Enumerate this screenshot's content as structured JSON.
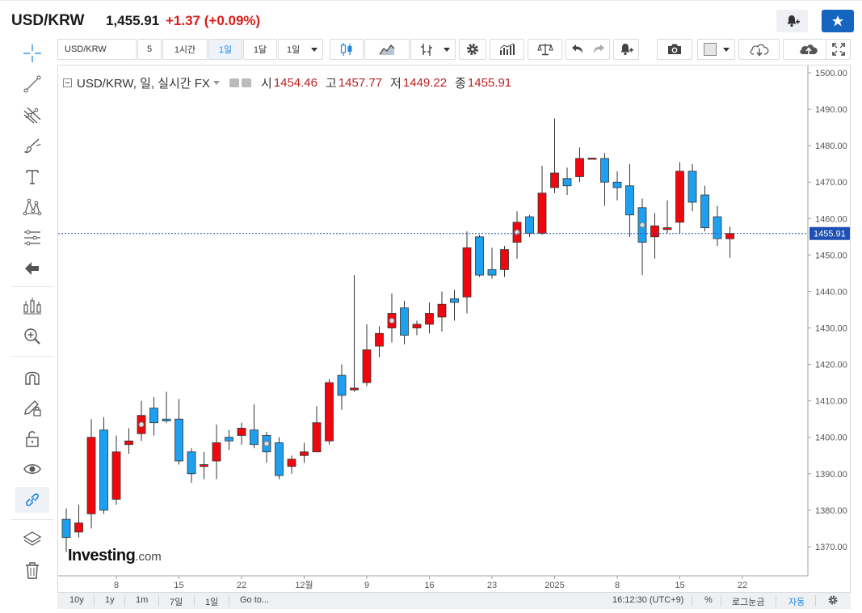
{
  "header": {
    "symbol": "USD/KRW",
    "price": "1,455.91",
    "change": "+1.37",
    "change_pct": "(+0.09%)"
  },
  "toolbar": {
    "symbol_value": "USD/KRW",
    "interval_5": "5",
    "interval_1h": "1시간",
    "interval_1d": "1일",
    "interval_1mo": "1달",
    "interval_1d_dropdown": "1일",
    "active_interval": "1일"
  },
  "legend": {
    "title": "USD/KRW, 일, 실시간 FX",
    "open_label": "시",
    "open": "1454.46",
    "high_label": "고",
    "high": "1457.77",
    "low_label": "저",
    "low": "1449.22",
    "close_label": "종",
    "close": "1455.91"
  },
  "watermark": {
    "brand": "Investing",
    "suffix": ".com"
  },
  "bottom": {
    "ranges": [
      "10y",
      "1y",
      "1m",
      "7일",
      "1일"
    ],
    "goto": "Go to...",
    "time": "16:12:30 (UTC+9)",
    "percent": "%",
    "log": "로그눈금",
    "auto": "자동"
  },
  "colors": {
    "up": "#f0070e",
    "down": "#1da0f0",
    "change": "#d91e18",
    "accent": "#1565c0"
  },
  "chart_data": {
    "type": "candlestick",
    "ylim": [
      1362,
      1502
    ],
    "yticks": [
      "1500.00",
      "1490.00",
      "1480.00",
      "1470.00",
      "1460.00",
      "1450.00",
      "1440.00",
      "1430.00",
      "1420.00",
      "1410.00",
      "1400.00",
      "1390.00",
      "1380.00",
      "1370.00"
    ],
    "xticks": [
      {
        "label": "8",
        "at": 4
      },
      {
        "label": "15",
        "at": 9
      },
      {
        "label": "22",
        "at": 14
      },
      {
        "label": "12월",
        "at": 19
      },
      {
        "label": "9",
        "at": 24
      },
      {
        "label": "16",
        "at": 29
      },
      {
        "label": "23",
        "at": 34
      },
      {
        "label": "2025",
        "at": 39
      },
      {
        "label": "8",
        "at": 44
      },
      {
        "label": "15",
        "at": 49
      },
      {
        "label": "22",
        "at": 54
      }
    ],
    "last_price_label": "1455.91",
    "last_price": 1455.91,
    "candles": [
      {
        "o": 1377.5,
        "h": 1380.5,
        "l": 1368.5,
        "c": 1372.5
      },
      {
        "o": 1374.0,
        "h": 1381.5,
        "l": 1372.5,
        "c": 1376.5
      },
      {
        "o": 1379.0,
        "h": 1405.0,
        "l": 1375.0,
        "c": 1400.0
      },
      {
        "o": 1402.0,
        "h": 1405.5,
        "l": 1379.0,
        "c": 1380.0
      },
      {
        "o": 1383.0,
        "h": 1400.5,
        "l": 1381.5,
        "c": 1396.0
      },
      {
        "o": 1398.0,
        "h": 1402.5,
        "l": 1395.5,
        "c": 1399.0
      },
      {
        "o": 1401.0,
        "h": 1410.0,
        "l": 1399.0,
        "c": 1406.0,
        "marker": true
      },
      {
        "o": 1408.0,
        "h": 1411.0,
        "l": 1400.5,
        "c": 1404.0
      },
      {
        "o": 1405.0,
        "h": 1412.5,
        "l": 1404.0,
        "c": 1404.5
      },
      {
        "o": 1405.0,
        "h": 1410.5,
        "l": 1392.5,
        "c": 1393.5
      },
      {
        "o": 1396.0,
        "h": 1397.0,
        "l": 1387.5,
        "c": 1390.0
      },
      {
        "o": 1392.0,
        "h": 1396.0,
        "l": 1388.5,
        "c": 1392.5
      },
      {
        "o": 1393.5,
        "h": 1403.5,
        "l": 1388.5,
        "c": 1398.5
      },
      {
        "o": 1400.0,
        "h": 1402.0,
        "l": 1396.5,
        "c": 1399.0
      },
      {
        "o": 1400.5,
        "h": 1404.0,
        "l": 1398.0,
        "c": 1402.5
      },
      {
        "o": 1402.0,
        "h": 1409.0,
        "l": 1397.0,
        "c": 1398.0
      },
      {
        "o": 1400.5,
        "h": 1401.5,
        "l": 1393.0,
        "c": 1396.0,
        "marker": true
      },
      {
        "o": 1398.5,
        "h": 1400.0,
        "l": 1388.5,
        "c": 1389.5
      },
      {
        "o": 1392.0,
        "h": 1395.0,
        "l": 1390.0,
        "c": 1394.0
      },
      {
        "o": 1395.0,
        "h": 1398.5,
        "l": 1393.0,
        "c": 1396.0
      },
      {
        "o": 1396.0,
        "h": 1408.5,
        "l": 1396.0,
        "c": 1404.0
      },
      {
        "o": 1399.0,
        "h": 1416.0,
        "l": 1398.0,
        "c": 1415.0
      },
      {
        "o": 1417.0,
        "h": 1420.0,
        "l": 1407.5,
        "c": 1411.5
      },
      {
        "o": 1413.0,
        "h": 1444.5,
        "l": 1412.5,
        "c": 1413.5
      },
      {
        "o": 1415.0,
        "h": 1431.0,
        "l": 1414.0,
        "c": 1424.0
      },
      {
        "o": 1425.0,
        "h": 1430.5,
        "l": 1422.0,
        "c": 1428.5
      },
      {
        "o": 1430.0,
        "h": 1439.5,
        "l": 1426.0,
        "c": 1434.0,
        "marker": true
      },
      {
        "o": 1435.5,
        "h": 1437.5,
        "l": 1425.5,
        "c": 1428.0
      },
      {
        "o": 1430.0,
        "h": 1432.0,
        "l": 1428.0,
        "c": 1431.0
      },
      {
        "o": 1431.0,
        "h": 1437.0,
        "l": 1428.5,
        "c": 1434.0
      },
      {
        "o": 1433.0,
        "h": 1440.0,
        "l": 1429.0,
        "c": 1436.5
      },
      {
        "o": 1438.0,
        "h": 1440.5,
        "l": 1432.0,
        "c": 1437.0
      },
      {
        "o": 1438.5,
        "h": 1456.5,
        "l": 1434.0,
        "c": 1452.0
      },
      {
        "o": 1455.0,
        "h": 1455.5,
        "l": 1444.0,
        "c": 1444.5
      },
      {
        "o": 1446.0,
        "h": 1452.0,
        "l": 1443.5,
        "c": 1444.5
      },
      {
        "o": 1446.0,
        "h": 1452.5,
        "l": 1444.0,
        "c": 1451.5
      },
      {
        "o": 1453.5,
        "h": 1462.0,
        "l": 1449.0,
        "c": 1459.0,
        "marker": true
      },
      {
        "o": 1460.5,
        "h": 1461.0,
        "l": 1455.0,
        "c": 1456.0
      },
      {
        "o": 1456.0,
        "h": 1474.5,
        "l": 1455.5,
        "c": 1467.0
      },
      {
        "o": 1468.5,
        "h": 1487.5,
        "l": 1467.0,
        "c": 1472.5
      },
      {
        "o": 1471.0,
        "h": 1474.0,
        "l": 1466.5,
        "c": 1469.0
      },
      {
        "o": 1471.5,
        "h": 1479.5,
        "l": 1470.0,
        "c": 1476.5
      },
      {
        "o": 1476.5,
        "h": 1476.5,
        "l": 1476.5,
        "c": 1476.6
      },
      {
        "o": 1476.5,
        "h": 1478.0,
        "l": 1463.5,
        "c": 1470.0
      },
      {
        "o": 1470.0,
        "h": 1473.0,
        "l": 1465.0,
        "c": 1468.5
      },
      {
        "o": 1469.0,
        "h": 1475.0,
        "l": 1455.0,
        "c": 1461.0
      },
      {
        "o": 1463.0,
        "h": 1465.5,
        "l": 1444.5,
        "c": 1453.5,
        "marker": true
      },
      {
        "o": 1455.0,
        "h": 1461.5,
        "l": 1449.0,
        "c": 1458.0
      },
      {
        "o": 1457.0,
        "h": 1465.0,
        "l": 1456.0,
        "c": 1457.5
      },
      {
        "o": 1459.0,
        "h": 1475.5,
        "l": 1456.0,
        "c": 1473.0
      },
      {
        "o": 1473.0,
        "h": 1475.0,
        "l": 1462.0,
        "c": 1464.5
      },
      {
        "o": 1466.5,
        "h": 1469.0,
        "l": 1456.5,
        "c": 1457.5
      },
      {
        "o": 1460.5,
        "h": 1463.5,
        "l": 1452.5,
        "c": 1454.5
      },
      {
        "o": 1454.46,
        "h": 1457.77,
        "l": 1449.22,
        "c": 1455.91
      }
    ]
  }
}
